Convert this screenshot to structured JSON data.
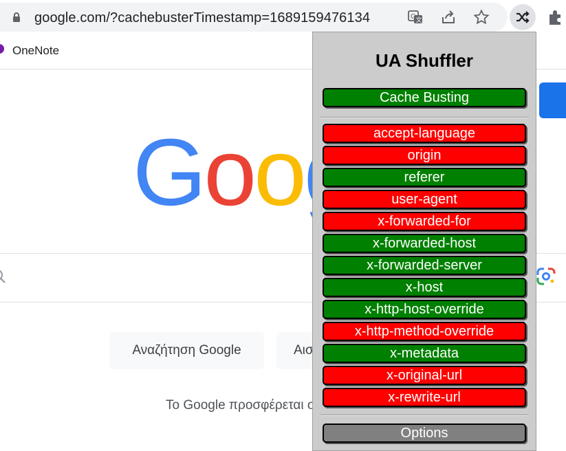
{
  "browser": {
    "url": "google.com/?cachebusterTimestamp=1689159476134",
    "bookmark_label": "OneNote"
  },
  "google": {
    "logo_letters": [
      "G",
      "o",
      "o",
      "g"
    ],
    "logo_colors": [
      "#4285f4",
      "#ea4335",
      "#fbbc05",
      "#4285f4"
    ],
    "search_button_label": "Αναζήτηση Google",
    "lucky_button_label": "Αισ",
    "offered_text": "Το Google προσφέρεται σ"
  },
  "popup": {
    "title": "UA Shuffler",
    "cache_busting": {
      "label": "Cache Busting",
      "state": "on"
    },
    "headers": [
      {
        "label": "accept-language",
        "state": "off"
      },
      {
        "label": "origin",
        "state": "off"
      },
      {
        "label": "referer",
        "state": "on"
      },
      {
        "label": "user-agent",
        "state": "off"
      },
      {
        "label": "x-forwarded-for",
        "state": "off"
      },
      {
        "label": "x-forwarded-host",
        "state": "on"
      },
      {
        "label": "x-forwarded-server",
        "state": "on"
      },
      {
        "label": "x-host",
        "state": "on"
      },
      {
        "label": "x-http-host-override",
        "state": "on"
      },
      {
        "label": "x-http-method-override",
        "state": "off"
      },
      {
        "label": "x-metadata",
        "state": "on"
      },
      {
        "label": "x-original-url",
        "state": "off"
      },
      {
        "label": "x-rewrite-url",
        "state": "off"
      }
    ],
    "options_label": "Options",
    "colors": {
      "on": "#008000",
      "off": "#ff0000",
      "neutral": "#808080"
    }
  }
}
